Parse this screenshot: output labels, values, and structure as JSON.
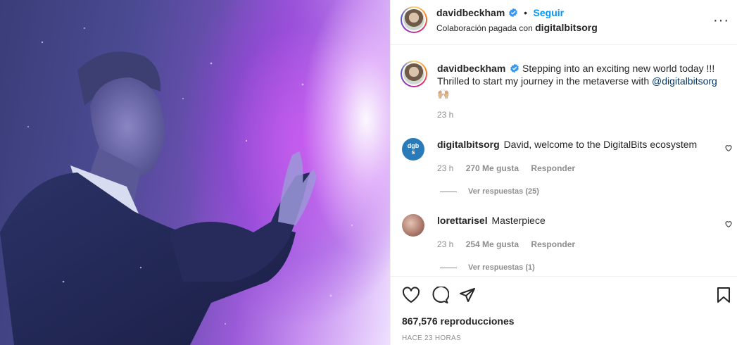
{
  "header": {
    "username": "davidbeckham",
    "follow_label": "Seguir",
    "separator": "•",
    "collab_prefix": "Colaboración pagada con",
    "collab_user": "digitalbitsorg",
    "more_label": "···"
  },
  "caption": {
    "username": "davidbeckham",
    "text": "Stepping into an exciting new world today !!! Thrilled to start my journey in the metaverse with",
    "mention": "@digitalbitsorg",
    "emoji": "🙌🏼",
    "time": "23 h"
  },
  "comments": [
    {
      "username": "digitalbitsorg",
      "text": "David, welcome to the DigitalBits ecosystem",
      "avatar_text": "dgbs",
      "time": "23 h",
      "likes": "270 Me gusta",
      "reply_label": "Responder",
      "view_replies": "Ver respuestas (25)"
    },
    {
      "username": "lorettarisel",
      "text": "Masterpiece",
      "time": "23 h",
      "likes": "254 Me gusta",
      "reply_label": "Responder",
      "view_replies": "Ver respuestas (1)"
    }
  ],
  "footer": {
    "views": "867,576 reproducciones",
    "timestamp": "HACE 23 HORAS"
  },
  "icons": [
    "verified-badge-icon",
    "more-options-icon",
    "heart-icon",
    "comment-icon",
    "share-icon",
    "bookmark-icon"
  ],
  "colors": {
    "link_blue": "#0095f6",
    "mention_blue": "#00376b",
    "muted": "#8e8e8e",
    "media_purple": "#9b5ad8"
  }
}
